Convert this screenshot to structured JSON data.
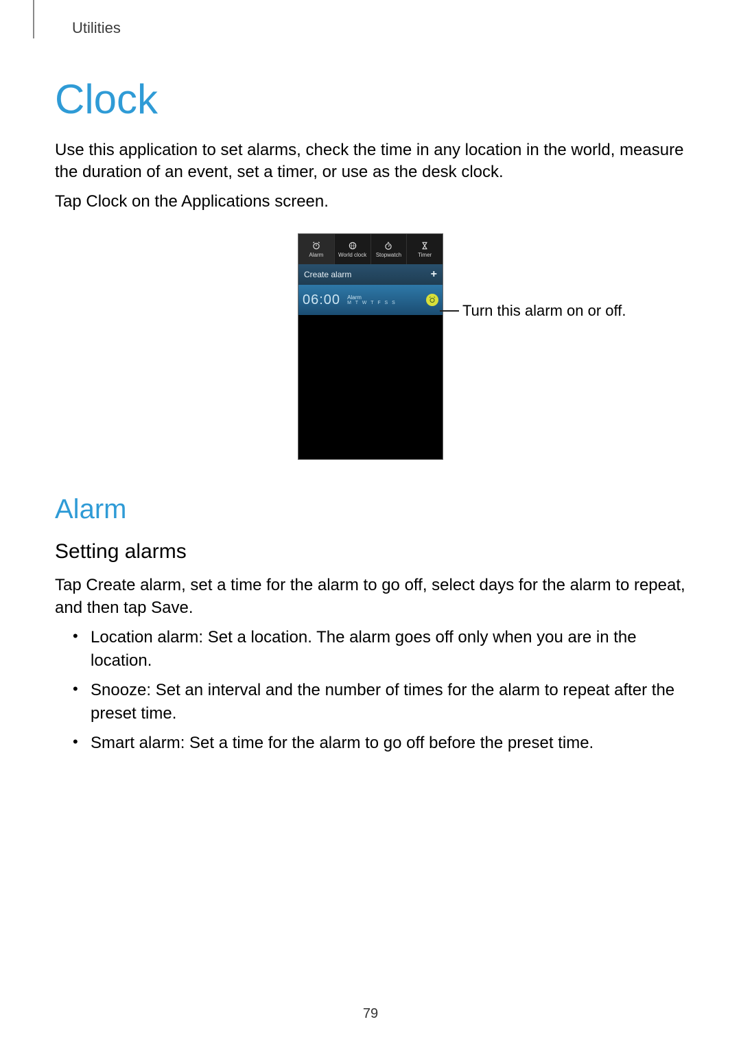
{
  "breadcrumb": "Utilities",
  "h1": "Clock",
  "intro1": "Use this application to set alarms, check the time in any location in the world, measure the duration of an event, set a timer, or use as the desk clock.",
  "intro2_a": "Tap ",
  "intro2_b": "Clock",
  "intro2_c": " on the Applications screen.",
  "screenshot": {
    "tabs": [
      {
        "label": "Alarm"
      },
      {
        "label": "World clock"
      },
      {
        "label": "Stopwatch"
      },
      {
        "label": "Timer"
      }
    ],
    "create_label": "Create alarm",
    "alarm": {
      "time": "06:00",
      "label": "Alarm",
      "days": "M T W T F S S"
    }
  },
  "callout": "Turn this alarm on or off.",
  "h2": "Alarm",
  "h3": "Setting alarms",
  "para2_a": "Tap ",
  "para2_b": "Create alarm",
  "para2_c": ", set a time for the alarm to go off, select days for the alarm to repeat, and then tap ",
  "para2_d": "Save",
  "para2_e": ".",
  "bullets": [
    {
      "term": "Location alarm",
      "desc": ": Set a location. The alarm goes off only when you are in the location."
    },
    {
      "term": "Snooze",
      "desc": ": Set an interval and the number of times for the alarm to repeat after the preset time."
    },
    {
      "term": "Smart alarm",
      "desc": ": Set a time for the alarm to go off before the preset time."
    }
  ],
  "page_number": "79"
}
